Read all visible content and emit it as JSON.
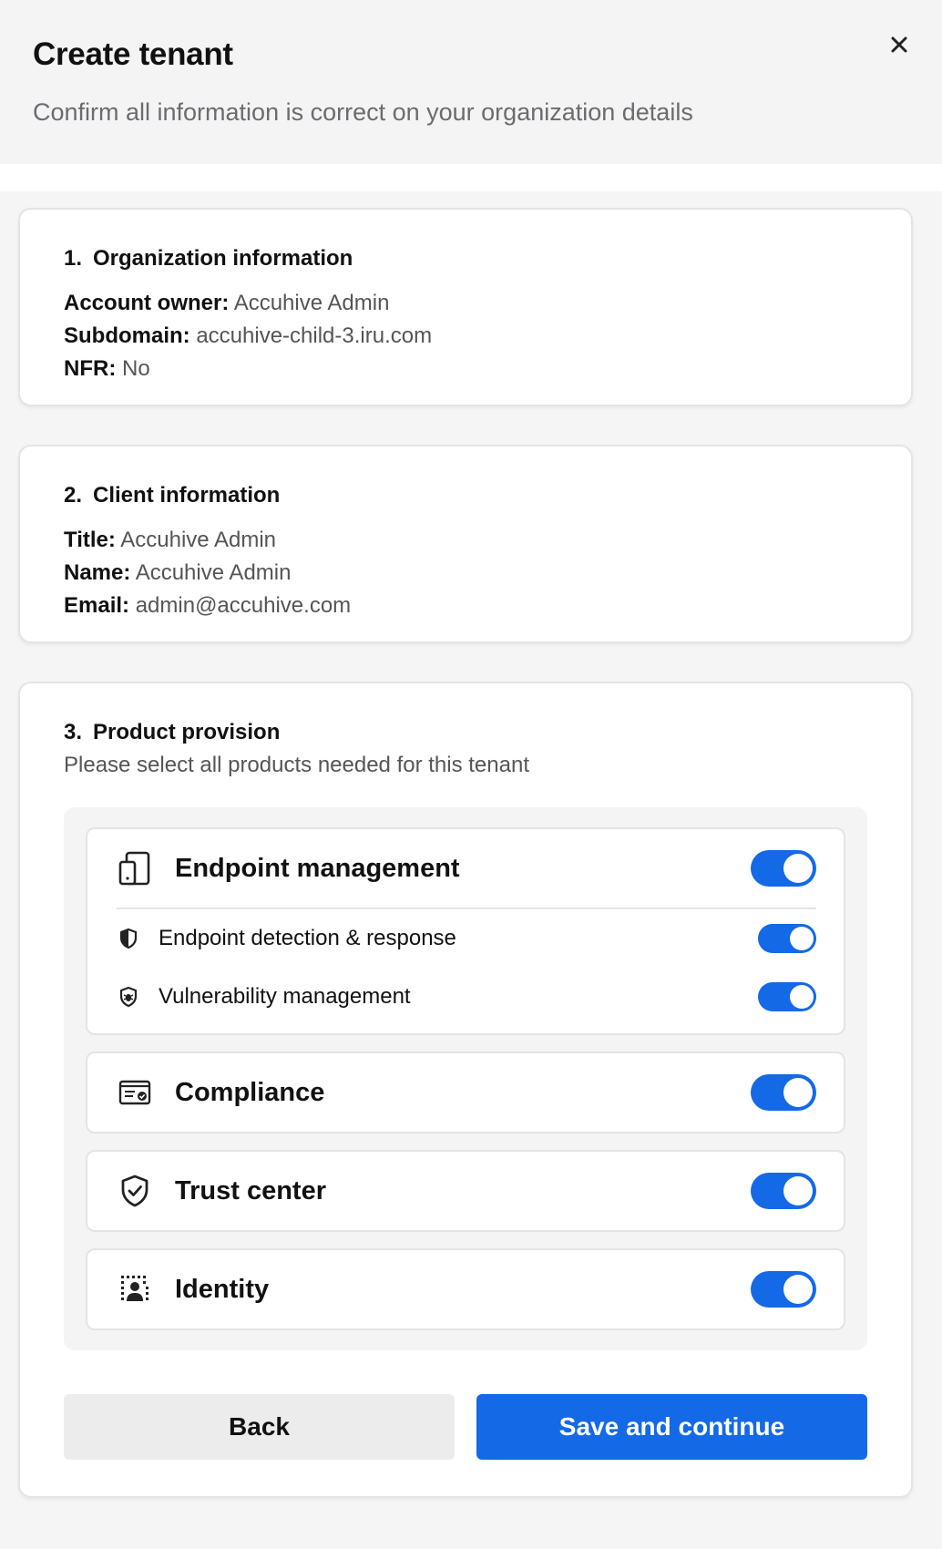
{
  "header": {
    "title": "Create tenant",
    "subtitle": "Confirm all information is correct on your organization details"
  },
  "organization": {
    "number": "1.",
    "title": "Organization information",
    "fields": [
      {
        "label": "Account owner:",
        "value": "Accuhive Admin"
      },
      {
        "label": "Subdomain:",
        "value": "accuhive-child-3.iru.com"
      },
      {
        "label": "NFR:",
        "value": "No"
      }
    ]
  },
  "client": {
    "number": "2.",
    "title": "Client information",
    "fields": [
      {
        "label": "Title:",
        "value": "Accuhive Admin"
      },
      {
        "label": "Name:",
        "value": "Accuhive Admin"
      },
      {
        "label": "Email:",
        "value": "admin@accuhive.com"
      }
    ]
  },
  "products": {
    "number": "3.",
    "title": "Product provision",
    "description": "Please select all products needed for this tenant",
    "items": [
      {
        "label": "Endpoint management",
        "icon": "device-icon",
        "enabled": true,
        "subitems": [
          {
            "label": "Endpoint detection & response",
            "icon": "half-shield-icon",
            "enabled": true
          },
          {
            "label": "Vulnerability management",
            "icon": "bug-shield-icon",
            "enabled": true
          }
        ]
      },
      {
        "label": "Compliance",
        "icon": "certificate-icon",
        "enabled": true
      },
      {
        "label": "Trust center",
        "icon": "shield-check-icon",
        "enabled": true
      },
      {
        "label": "Identity",
        "icon": "identity-icon",
        "enabled": true
      }
    ]
  },
  "actions": {
    "back_label": "Back",
    "save_label": "Save and continue"
  },
  "colors": {
    "accent": "#1469e6",
    "background": "#f4f4f5"
  }
}
